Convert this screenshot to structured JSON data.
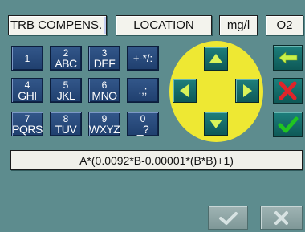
{
  "header": {
    "parameter_value": "TRB COMPENS.",
    "location_label": "LOCATION",
    "unit_label": "mg/l",
    "channel_label": "O2"
  },
  "keypad": [
    {
      "digit": "1",
      "letters": ""
    },
    {
      "digit": "2",
      "letters": "ABC"
    },
    {
      "digit": "3",
      "letters": "DEF"
    },
    {
      "digit": "",
      "letters": "+-*/:"
    },
    {
      "digit": "4",
      "letters": "GHI"
    },
    {
      "digit": "5",
      "letters": "JKL"
    },
    {
      "digit": "6",
      "letters": "MNO"
    },
    {
      "digit": "",
      "letters": ".,;"
    },
    {
      "digit": "7",
      "letters": "PQRS"
    },
    {
      "digit": "8",
      "letters": "TUV"
    },
    {
      "digit": "9",
      "letters": "WXYZ"
    },
    {
      "digit": "0",
      "letters": "_?"
    }
  ],
  "formula": {
    "text": "A*(0.0092*B-0.00001*(B*B)+1)"
  },
  "icons": {
    "dpad_up": "arrow-up-icon",
    "dpad_down": "arrow-down-icon",
    "dpad_left": "arrow-left-icon",
    "dpad_right": "arrow-right-icon",
    "backspace": "backspace-arrow-icon",
    "delete": "red-x-icon",
    "confirm": "checkmark-icon",
    "ok_disabled": "checkmark-icon",
    "cancel_disabled": "x-icon"
  },
  "colors": {
    "background": "#5d8c8e",
    "key_blue": "#284b7e",
    "dpad_yellow": "#eee833",
    "button_teal": "#1d7f7c",
    "delete_red": "#e0242a",
    "confirm_green": "#20c520",
    "backspace_green": "#c7f04a"
  }
}
